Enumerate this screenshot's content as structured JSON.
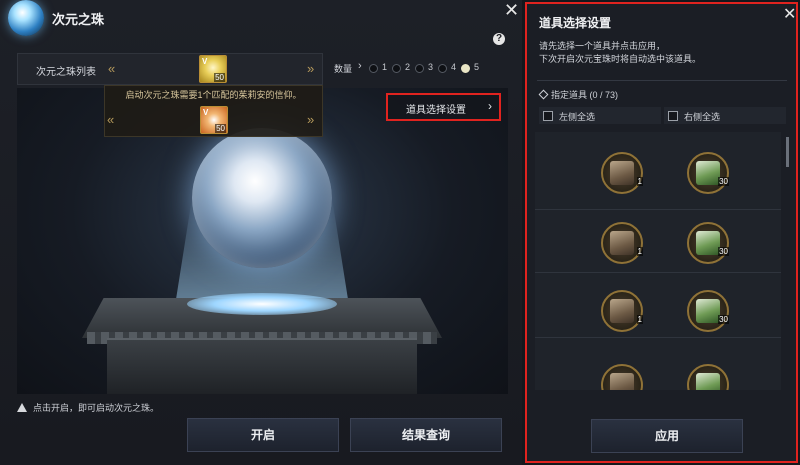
{
  "window": {
    "title": "次元之珠"
  },
  "orb_list": {
    "label": "次元之珠列表",
    "prev_symbol": "«",
    "next_symbol": "»",
    "main_item": {
      "level": "V",
      "count": "50",
      "icon": "yellow-orb-icon"
    }
  },
  "quantity": {
    "label": "数量",
    "arrow": "›",
    "options": [
      "1",
      "2",
      "3",
      "4",
      "5"
    ],
    "selected": "5"
  },
  "tooltip": {
    "message": "启动次元之珠需要1个匹配的茱莉安的信仰。",
    "item": {
      "level": "V",
      "count": "50",
      "icon": "orange-item-icon"
    }
  },
  "item_select_button": {
    "label": "道具选择设置",
    "arrow": "›"
  },
  "notice": {
    "text": "点击开启，即可启动次元之珠。"
  },
  "buttons": {
    "open": "开启",
    "result": "结果查询"
  },
  "panel": {
    "title": "道具选择设置",
    "description_line1": "请先选择一个道具并点击应用，",
    "description_line2": "下次开启次元宝珠时将自动选中该道具。",
    "assigned_label": "指定道具 (0 / 73)",
    "select_all_left": "左侧全选",
    "select_all_right": "右侧全选",
    "items": [
      {
        "side": "left",
        "count": "1",
        "icon": "fighter-portrait-icon"
      },
      {
        "side": "right",
        "count": "30",
        "icon": "green-potion-icon"
      },
      {
        "side": "left",
        "count": "1",
        "icon": "fighter-portrait-icon"
      },
      {
        "side": "right",
        "count": "30",
        "icon": "green-potion-icon"
      },
      {
        "side": "left",
        "count": "1",
        "icon": "fighter-portrait-icon"
      },
      {
        "side": "right",
        "count": "30",
        "icon": "green-potion-icon"
      },
      {
        "side": "left",
        "count": "",
        "icon": "fighter-portrait-icon"
      },
      {
        "side": "right",
        "count": "",
        "icon": "green-potion-icon"
      }
    ],
    "apply": "应用"
  },
  "colors": {
    "highlight_border": "#e0231f",
    "gold_frame": "#8f7237"
  }
}
